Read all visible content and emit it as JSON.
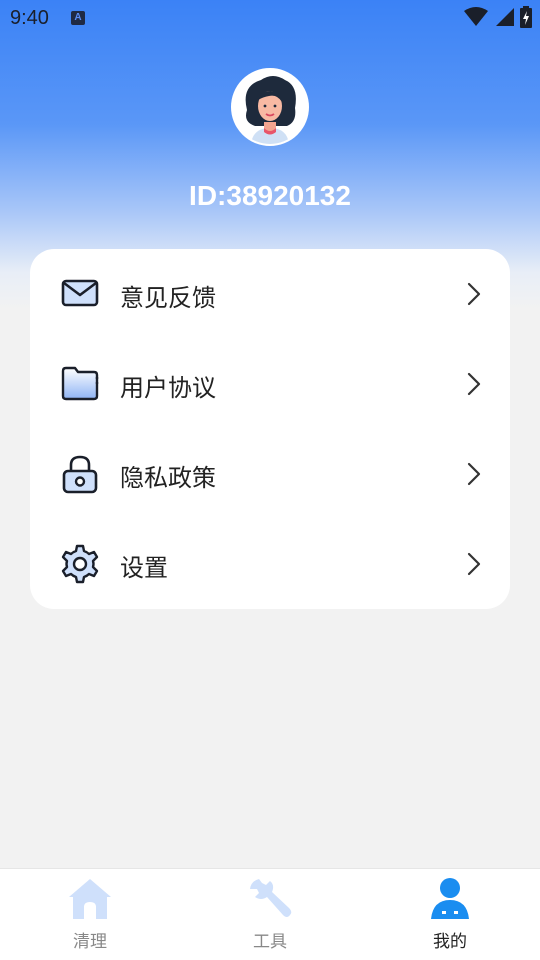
{
  "status_bar": {
    "time": "9:40",
    "notification_badge": "A"
  },
  "profile": {
    "id_text": "ID:38920132",
    "avatar": "woman-avatar"
  },
  "menu": {
    "items": [
      {
        "label": "意见反馈",
        "icon": "mail-icon"
      },
      {
        "label": "用户协议",
        "icon": "folder-icon"
      },
      {
        "label": "隐私政策",
        "icon": "lock-icon"
      },
      {
        "label": "设置",
        "icon": "gear-icon"
      }
    ]
  },
  "tabbar": {
    "tabs": [
      {
        "label": "清理",
        "icon": "home-icon",
        "active": false
      },
      {
        "label": "工具",
        "icon": "wrench-icon",
        "active": false
      },
      {
        "label": "我的",
        "icon": "user-icon",
        "active": true
      }
    ]
  },
  "colors": {
    "accent": "#3b82f6",
    "icon_light": "#cfe0fb",
    "active_tab_label": "#222222",
    "inactive_tab_label": "#888888"
  }
}
